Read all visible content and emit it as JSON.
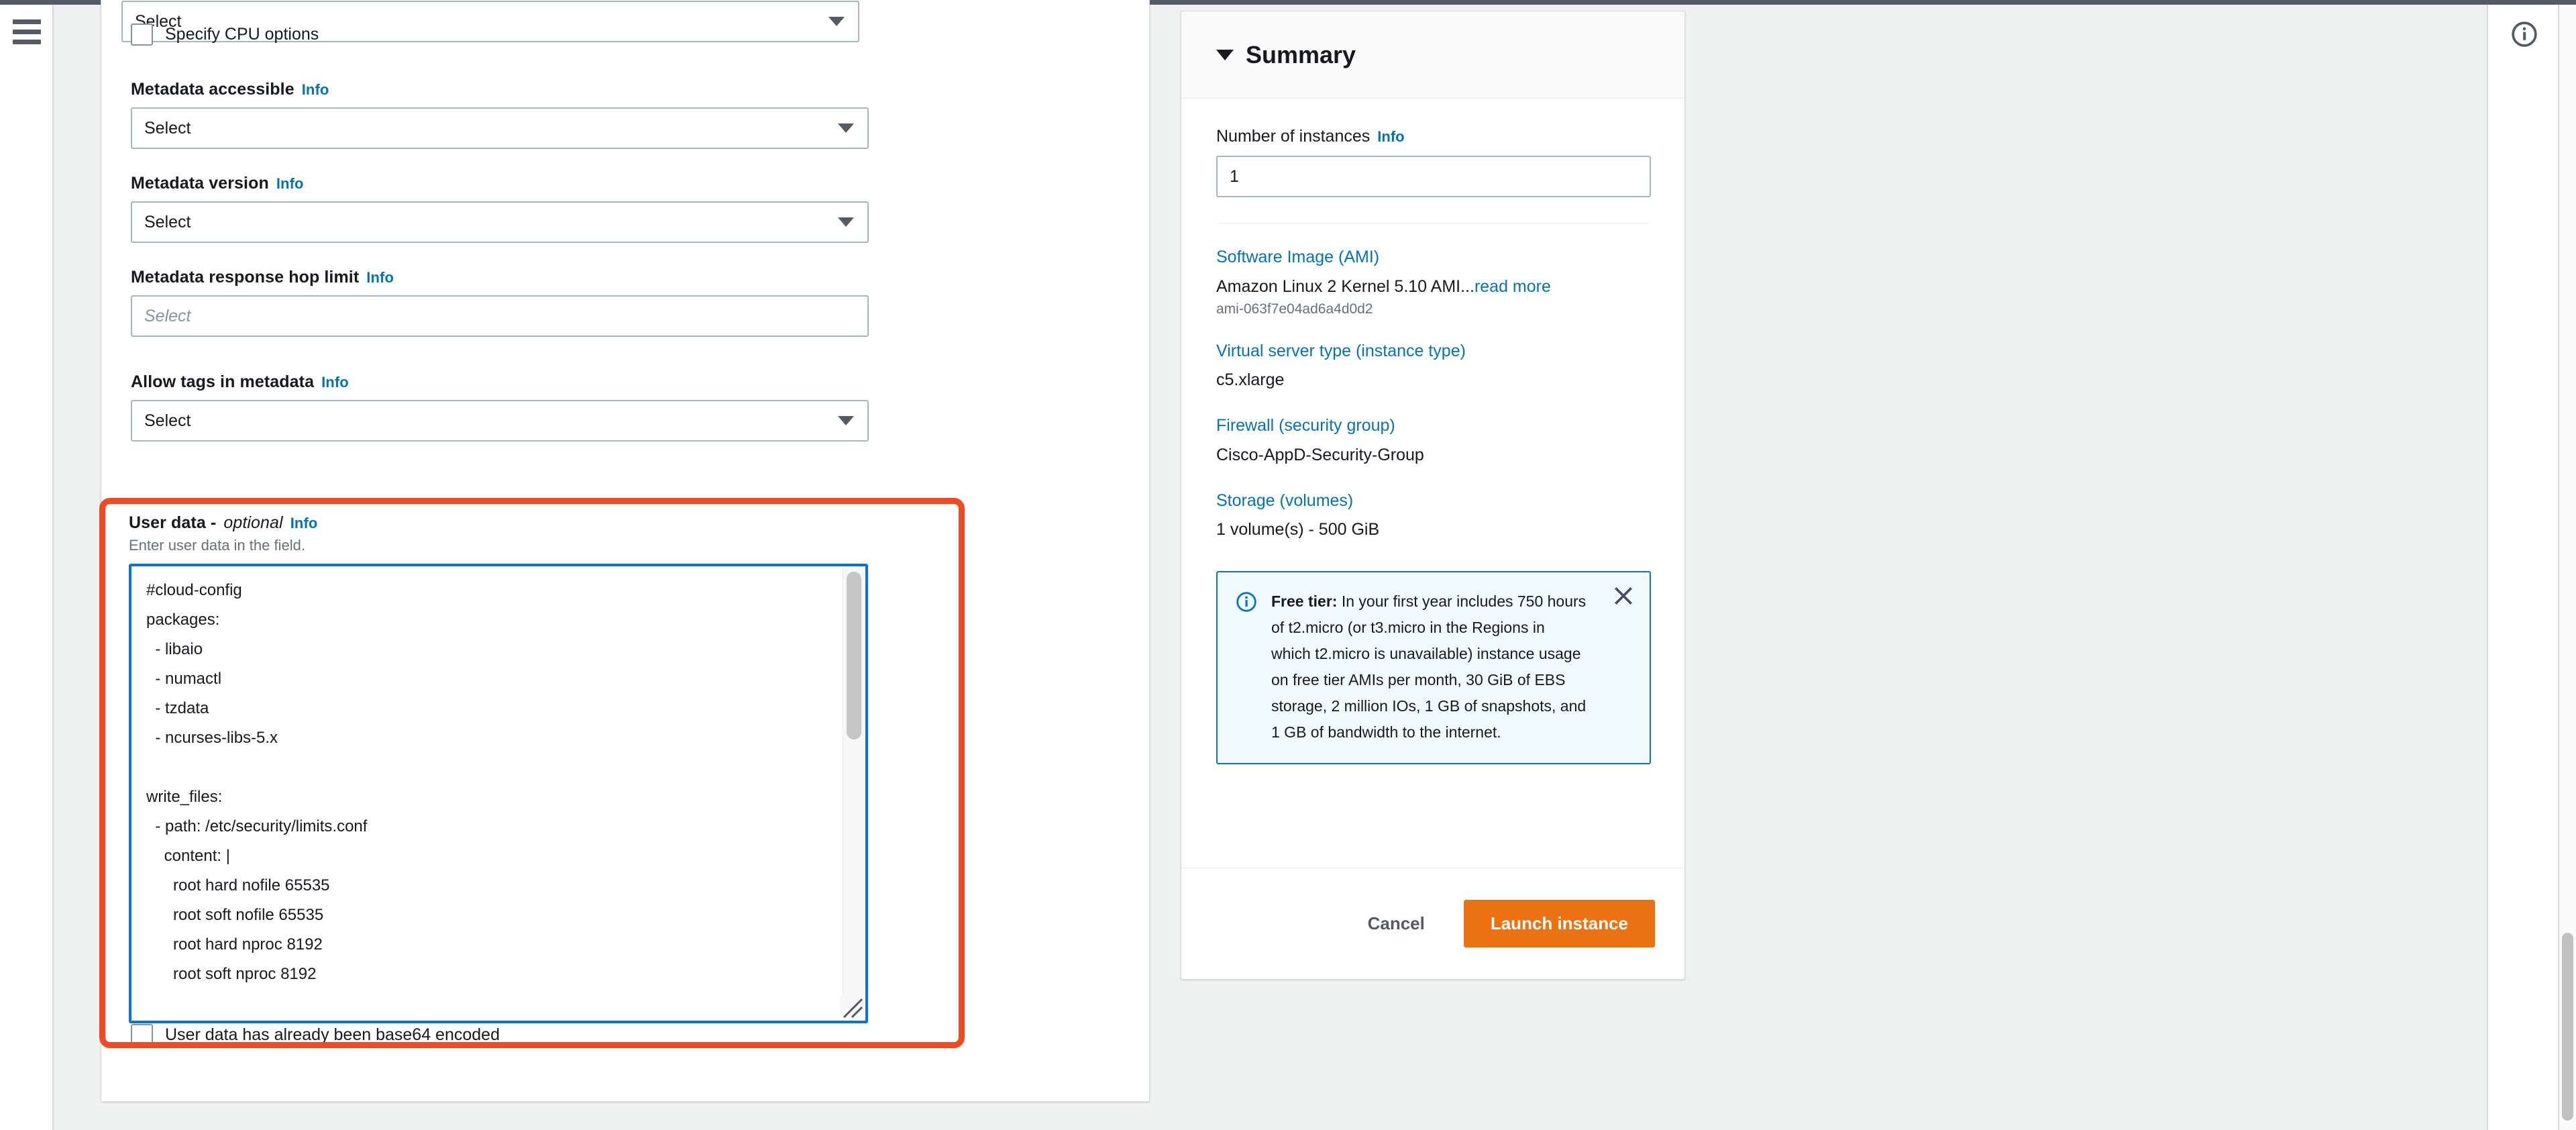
{
  "chrome": {
    "menu_icon": "hamburger-icon",
    "info_icon": "info-circle-icon"
  },
  "form": {
    "top_select": {
      "label": "",
      "value": "Select"
    },
    "specify_cpu": {
      "label": "Specify CPU options",
      "checked": false
    },
    "metadata_accessible": {
      "label": "Metadata accessible",
      "info": "Info",
      "value": "Select"
    },
    "metadata_version": {
      "label": "Metadata version",
      "info": "Info",
      "value": "Select"
    },
    "hop_limit": {
      "label": "Metadata response hop limit",
      "info": "Info",
      "placeholder": "Select"
    },
    "allow_tags": {
      "label": "Allow tags in metadata",
      "info": "Info",
      "value": "Select"
    },
    "user_data": {
      "label": "User data -",
      "optional": "optional",
      "info": "Info",
      "description": "Enter user data in the field.",
      "content": "#cloud-config\npackages:\n  - libaio\n  - numactl\n  - tzdata\n  - ncurses-libs-5.x\n\nwrite_files:\n  - path: /etc/security/limits.conf\n    content: |\n      root hard nofile 65535\n      root soft nofile 65535\n      root hard nproc 8192\n      root soft nproc 8192"
    },
    "base64_checkbox": {
      "label": "User data has already been base64 encoded",
      "checked": false
    },
    "highlight_color": "#f2491f"
  },
  "summary": {
    "title": "Summary",
    "instances": {
      "label": "Number of instances",
      "info": "Info",
      "value": "1"
    },
    "sections": [
      {
        "link": "Software Image (AMI)",
        "value": "Amazon Linux 2 Kernel 5.10 AMI...",
        "read_more": "read more",
        "sub": "ami-063f7e04ad6a4d0d2"
      },
      {
        "link": "Virtual server type (instance type)",
        "value": "c5.xlarge",
        "read_more": "",
        "sub": ""
      },
      {
        "link": "Firewall (security group)",
        "value": "Cisco-AppD-Security-Group",
        "read_more": "",
        "sub": ""
      },
      {
        "link": "Storage (volumes)",
        "value": "1 volume(s) - 500 GiB",
        "read_more": "",
        "sub": ""
      }
    ],
    "free_tier": {
      "title": "Free tier:",
      "body": " In your first year includes 750 hours of t2.micro (or t3.micro in the Regions in which t2.micro is unavailable) instance usage on free tier AMIs per month, 30 GiB of EBS storage, 2 million IOs, 1 GB of snapshots, and 1 GB of bandwidth to the internet.",
      "close_icon": "close-icon"
    },
    "cancel_label": "Cancel",
    "launch_label": "Launch instance",
    "launch_color": "#ec7211"
  }
}
